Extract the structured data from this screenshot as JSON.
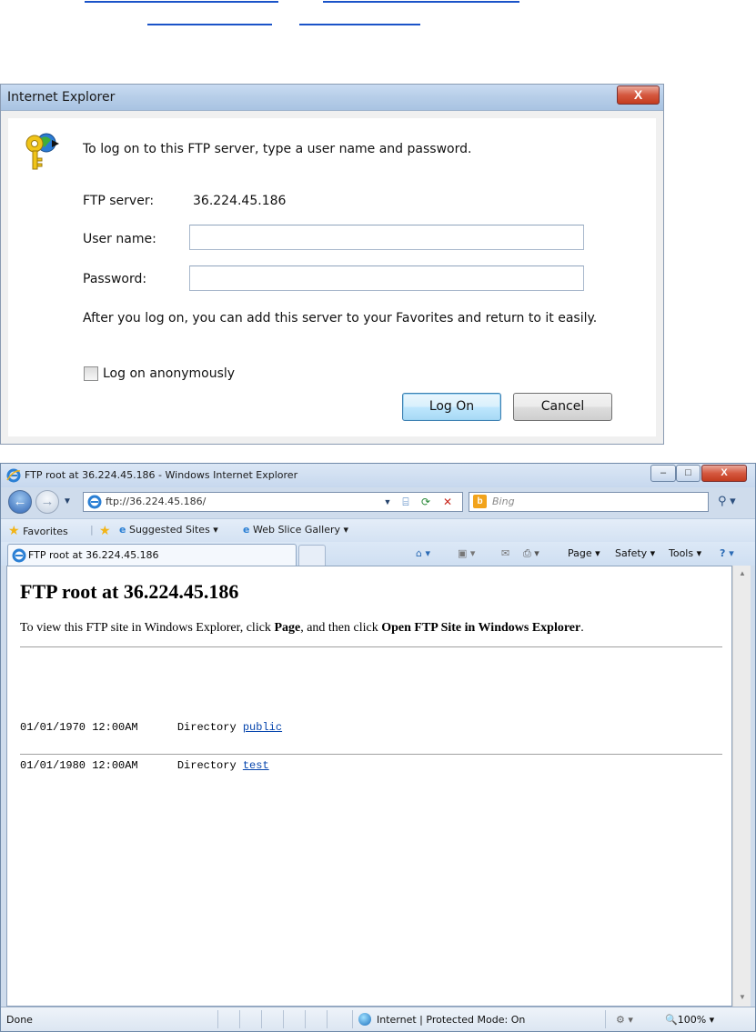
{
  "dialog": {
    "title": "Internet Explorer",
    "close_label": "X",
    "prompt": "To log on to this FTP server, type a user name and password.",
    "ftp_server_label": "FTP server:",
    "ftp_server_value": "36.224.45.186",
    "username_label": "User name:",
    "username_value": "",
    "password_label": "Password:",
    "password_value": "",
    "info": "After you log on, you can add this server to your Favorites and return to it easily.",
    "anonymous_label": "Log on anonymously",
    "anonymous_checked": false,
    "logon_button": "Log On",
    "cancel_button": "Cancel"
  },
  "browser": {
    "window_title": "FTP root at 36.224.45.186 - Windows Internet Explorer",
    "address": "ftp://36.224.45.186/",
    "search_placeholder": "Bing",
    "favorites": {
      "favorites_label": "Favorites",
      "suggested_sites": "Suggested Sites",
      "web_slice_gallery": "Web Slice Gallery"
    },
    "tab_title": "FTP root at 36.224.45.186",
    "commands": {
      "page": "Page",
      "safety": "Safety",
      "tools": "Tools"
    },
    "content": {
      "heading": "FTP root at 36.224.45.186",
      "instruction_pre": "To view this FTP site in Windows Explorer, click ",
      "instruction_page": "Page",
      "instruction_mid": ", and then click ",
      "instruction_open": "Open FTP Site in Windows Explorer",
      "instruction_end": ".",
      "entries": [
        {
          "date": "01/01/1970 12:00AM",
          "type": "Directory",
          "name": "public"
        },
        {
          "date": "01/01/1980 12:00AM",
          "type": "Directory",
          "name": "test"
        }
      ]
    },
    "status": {
      "text": "Done",
      "zone": "Internet | Protected Mode: On",
      "zoom": "100%"
    }
  }
}
